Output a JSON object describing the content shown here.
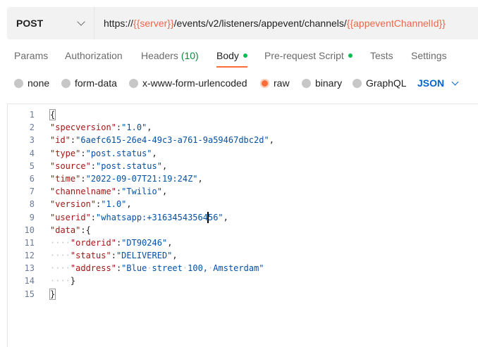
{
  "request": {
    "method": "POST",
    "url_parts": [
      {
        "text": "https://",
        "var": false
      },
      {
        "text": "{{server}}",
        "var": true
      },
      {
        "text": "/events/v2/listeners/appevent/channels/",
        "var": false
      },
      {
        "text": "{{appeventChannelId}}",
        "var": true
      }
    ]
  },
  "tabs": [
    {
      "label": "Params"
    },
    {
      "label": "Authorization"
    },
    {
      "label": "Headers",
      "count": "(10)"
    },
    {
      "label": "Body",
      "active": true,
      "indicator": true
    },
    {
      "label": "Pre-request Script",
      "indicator": true
    },
    {
      "label": "Tests"
    },
    {
      "label": "Settings"
    }
  ],
  "body_types": [
    {
      "label": "none"
    },
    {
      "label": "form-data"
    },
    {
      "label": "x-www-form-urlencoded"
    },
    {
      "label": "raw",
      "selected": true
    },
    {
      "label": "binary"
    },
    {
      "label": "GraphQL"
    }
  ],
  "format_select": "JSON",
  "colors": {
    "accent": "#ff6c37",
    "indicator": "#0cbb52",
    "link_blue": "#0265d2",
    "url_variable": "#e8684a"
  },
  "editor": {
    "lines": [
      {
        "n": "1",
        "indent": "",
        "key": "",
        "value": "",
        "punct": "{"
      },
      {
        "n": "2",
        "indent": "",
        "key": "\"specversion\"",
        "value": "\"1.0\"",
        "punct": ","
      },
      {
        "n": "3",
        "indent": "",
        "key": "\"id\"",
        "value": "\"6aefc615-26e4-49c3-a761-9a59467dbc2d\"",
        "punct": ","
      },
      {
        "n": "4",
        "indent": "",
        "key": "\"type\"",
        "value": "\"post.status\"",
        "punct": ","
      },
      {
        "n": "5",
        "indent": "",
        "key": "\"source\"",
        "value": "\"post.status\"",
        "punct": ","
      },
      {
        "n": "6",
        "indent": "",
        "key": "\"time\"",
        "value": "\"2022-09-07T21:19:24Z\"",
        "punct": ","
      },
      {
        "n": "7",
        "indent": "",
        "key": "\"channelname\"",
        "value": "\"Twilio\"",
        "punct": ","
      },
      {
        "n": "8",
        "indent": "",
        "key": "\"version\"",
        "value": "\"1.0\"",
        "punct": ","
      },
      {
        "n": "9",
        "indent": "",
        "key": "\"userid\"",
        "value": "\"whatsapp:+3163454356456\"",
        "punct": ","
      },
      {
        "n": "10",
        "indent": "",
        "key": "\"data\"",
        "value": "",
        "punct": "{"
      },
      {
        "n": "11",
        "indent": "····",
        "key": "\"orderid\"",
        "value": "\"DT90246\"",
        "punct": ","
      },
      {
        "n": "12",
        "indent": "····",
        "key": "\"status\"",
        "value": "\"DELIVERED\"",
        "punct": ","
      },
      {
        "n": "13",
        "indent": "····",
        "key": "\"address\"",
        "value": "\"Blue·street·100,·Amsterdam\"",
        "punct": ""
      },
      {
        "n": "14",
        "indent": "····",
        "key": "",
        "value": "",
        "punct": "}"
      },
      {
        "n": "15",
        "indent": "",
        "key": "",
        "value": "",
        "punct": "}"
      }
    ]
  }
}
